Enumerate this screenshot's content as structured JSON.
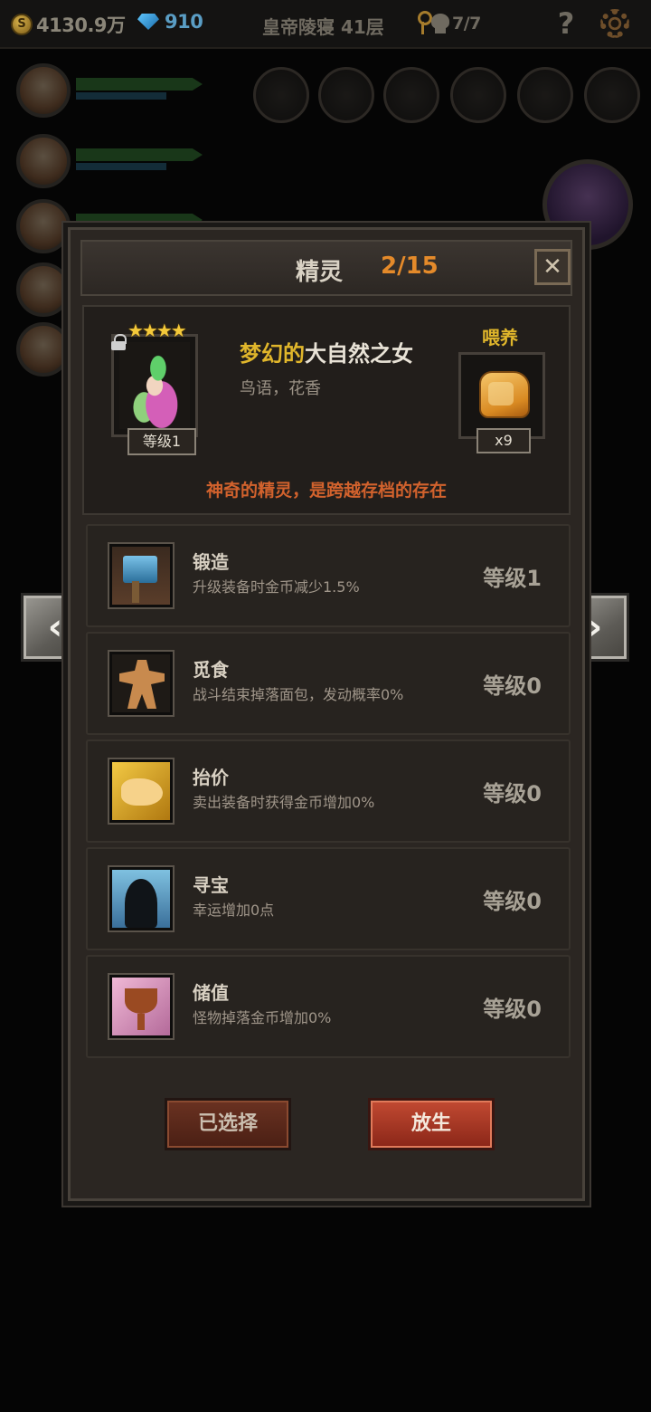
{
  "hud": {
    "gold": "4130.9万",
    "gold_coin_symbol": "S",
    "gems": "910",
    "floor": "皇帝陵寝 41层",
    "keys": "7/7",
    "help": "?",
    "icons": [
      "coin-icon",
      "gem-icon",
      "key-icon",
      "skull-icon",
      "help-icon",
      "gear-icon"
    ]
  },
  "modal": {
    "title": "精灵",
    "count": "2/15",
    "close": "✕",
    "pet": {
      "stars": "★★★★",
      "level": "等级1",
      "name_prefix": "梦幻的",
      "name": "大自然之女",
      "desc": "鸟语，花香",
      "tagline": "神奇的精灵，是跨越存档的存在"
    },
    "feed": {
      "label": "喂养",
      "count": "x9"
    },
    "skills": [
      {
        "name": "锻造",
        "desc": "升级装备时金币减少1.5%",
        "level": "等级1",
        "icon": "anvil-icon"
      },
      {
        "name": "觅食",
        "desc": "战斗结束掉落面包，发动概率0%",
        "level": "等级0",
        "icon": "gingerbread-icon"
      },
      {
        "name": "抬价",
        "desc": "卖出装备时获得金币增加0%",
        "level": "等级0",
        "icon": "hand-icon"
      },
      {
        "name": "寻宝",
        "desc": "幸运增加0点",
        "level": "等级0",
        "icon": "silhouette-icon"
      },
      {
        "name": "储值",
        "desc": "怪物掉落金币增加0%",
        "level": "等级0",
        "icon": "cup-icon"
      }
    ],
    "buttons": {
      "selected": "已选择",
      "release": "放生"
    }
  },
  "nav": {
    "prev": "‹",
    "next": "›"
  },
  "colors": {
    "accent_orange": "#e48a2a",
    "gold_text": "#e0b62b",
    "tagline": "#d2622d",
    "release_button": "#c24a32"
  }
}
